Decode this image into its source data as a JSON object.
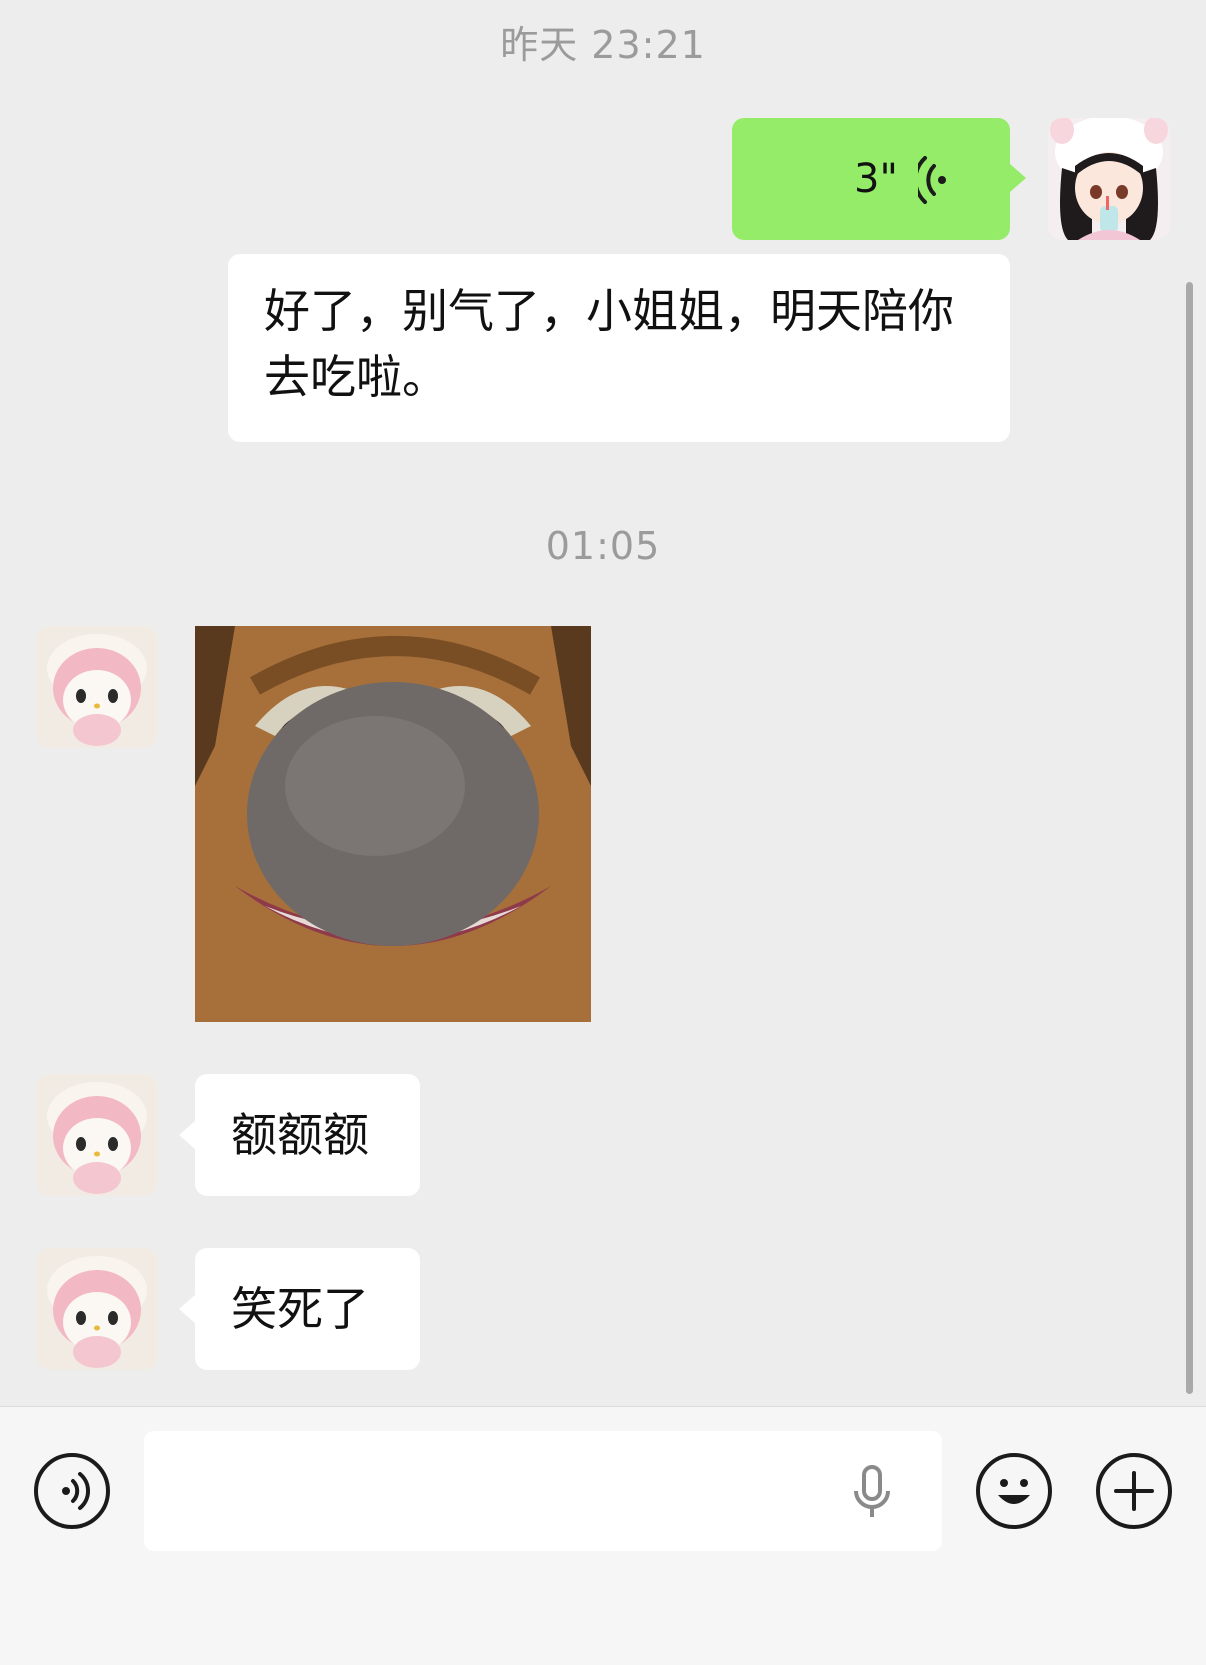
{
  "messages": {
    "time1": "昨天 23:21",
    "voice_duration": "3\"",
    "outgoing_text": "好了，别气了，小姐姐，明天陪你去吃啦。",
    "time2": "01:05",
    "reply1": "额额额",
    "reply2": "笑死了"
  },
  "icons": {
    "voice_played": "voice-wave-icon",
    "voice_toggle": "voice-mode-icon",
    "mic": "microphone-icon",
    "emoji": "emoji-icon",
    "more": "plus-icon"
  },
  "colors": {
    "background": "#ededed",
    "outgoing_bubble": "#95ec69",
    "incoming_bubble": "#ffffff",
    "timestamp": "#9b9b9b"
  }
}
